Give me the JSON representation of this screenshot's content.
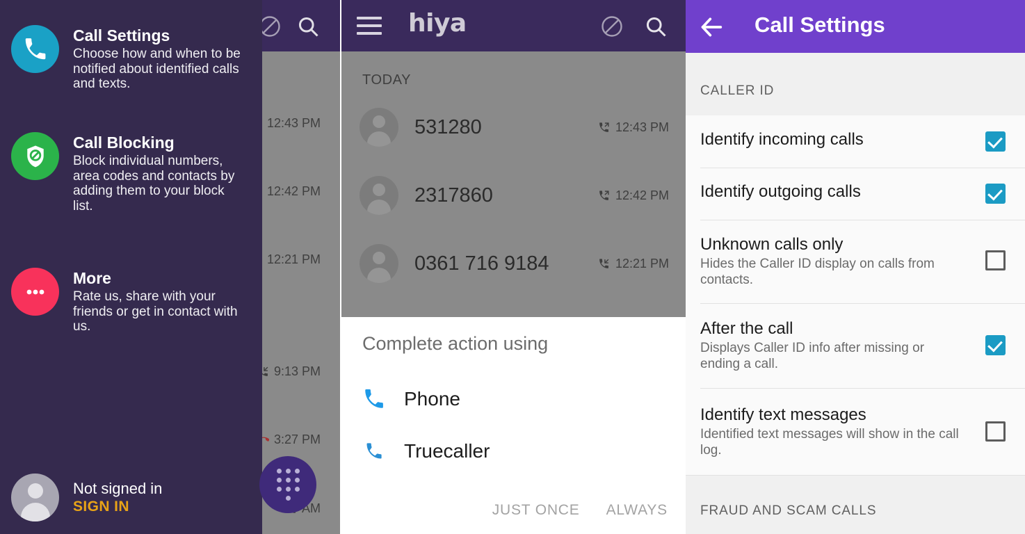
{
  "drawer": {
    "items": [
      {
        "icon": "phone-icon",
        "icon_color": "#1aa1c6",
        "title": "Call Settings",
        "desc": "Choose how and when to be notified about identified calls and texts."
      },
      {
        "icon": "shield-block-icon",
        "icon_color": "#2bb34a",
        "title": "Call Blocking",
        "desc": "Block individual numbers, area codes and contacts by adding them to your block list."
      },
      {
        "icon": "more-dots-icon",
        "icon_color": "#f8325b",
        "title": "More",
        "desc": "Rate us, share with your friends or get in contact with us."
      }
    ],
    "account": {
      "name": "Not signed in",
      "sign_in_label": "SIGN IN",
      "sign_in_color": "#e8a317",
      "avatar": "person-avatar"
    },
    "background_color": "#352a4e"
  },
  "behind_panel": {
    "appbar_color": "#3a2a5c",
    "block_icon": "block-icon",
    "search_icon": "search-icon",
    "times": [
      {
        "label": "12:43 PM",
        "type": "outgoing"
      },
      {
        "label": "12:42 PM",
        "type": "outgoing"
      },
      {
        "label": "12:21 PM",
        "type": "incoming"
      },
      {
        "label": "9:13 PM",
        "type": "incoming"
      },
      {
        "label": "3:27 PM",
        "type": "missed"
      },
      {
        "label": "AM",
        "type": "incoming"
      }
    ]
  },
  "hiya_app": {
    "logo": "hiya",
    "menu_icon": "hamburger-icon",
    "block_icon": "block-icon",
    "search_icon": "search-icon",
    "appbar_color": "#3a2a5c",
    "section_label": "TODAY",
    "calls": [
      {
        "number": "531280",
        "time": "12:43 PM",
        "type": "outgoing"
      },
      {
        "number": "2317860",
        "time": "12:42 PM",
        "type": "outgoing"
      },
      {
        "number": "0361 716 9184",
        "time": "12:21 PM",
        "type": "incoming"
      }
    ],
    "fab": {
      "icon": "dialpad-icon",
      "color": "#3f2a7a"
    }
  },
  "dialog": {
    "title": "Complete action using",
    "items": [
      {
        "label": "Phone",
        "icon": "phone-handset-icon"
      },
      {
        "label": "Truecaller",
        "icon": "phone-handset-icon"
      }
    ],
    "buttons": {
      "just_once": "JUST ONCE",
      "always": "ALWAYS"
    }
  },
  "call_settings": {
    "header": {
      "back_icon": "back-arrow-icon",
      "title": "Call Settings",
      "color": "#7040cc"
    },
    "sections": [
      {
        "label": "CALLER ID",
        "rows": [
          {
            "title": "Identify incoming calls",
            "sub": "",
            "checked": true
          },
          {
            "title": "Identify outgoing calls",
            "sub": "",
            "checked": true
          },
          {
            "title": "Unknown calls only",
            "sub": "Hides the Caller ID display on calls from contacts.",
            "checked": false
          },
          {
            "title": "After the call",
            "sub": "Displays Caller ID info after missing or ending a call.",
            "checked": true
          },
          {
            "title": "Identify text messages",
            "sub": "Identified text messages will show in the call log.",
            "checked": false
          }
        ]
      },
      {
        "label": "FRAUD AND SCAM CALLS",
        "rows": []
      }
    ],
    "checkbox_on_color": "#1b9bc4"
  }
}
